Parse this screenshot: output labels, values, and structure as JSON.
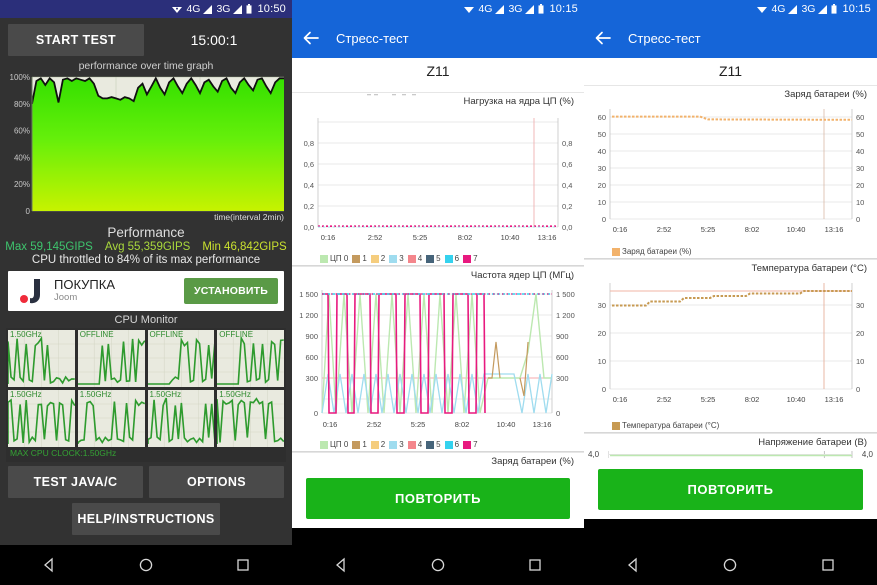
{
  "left": {
    "statusbar": {
      "wifi": "wifi-icon",
      "net1": "4G",
      "net2": "3G",
      "battery": "battery-icon",
      "time": "10:50"
    },
    "start_button": "START TEST",
    "timer": "15:00:1",
    "graph_title": "performance over time graph",
    "graph_xlabel": "time(interval 2min)",
    "y_ticks": [
      "100%",
      "80%",
      "60%",
      "40%",
      "20%",
      "0"
    ],
    "performance_heading": "Performance",
    "stat_max": "Max 59,145GIPS",
    "stat_avg": "Avg 55,359GIPS",
    "stat_min": "Min 46,842GIPS",
    "throttle_note": "CPU throttled to 84% of its max performance",
    "ad": {
      "title": "ПОКУПКА",
      "subtitle": "Joom",
      "cta": "УСТАНОВИТЬ",
      "logo": "joom-logo-icon"
    },
    "cpu_monitor_title": "CPU Monitor",
    "cpu_cores": [
      {
        "label": "1.50GHz",
        "state": "online"
      },
      {
        "label": "OFFLINE",
        "state": "offline"
      },
      {
        "label": "OFFLINE",
        "state": "offline"
      },
      {
        "label": "OFFLINE",
        "state": "offline"
      },
      {
        "label": "1.50GHz",
        "state": "online"
      },
      {
        "label": "1.50GHz",
        "state": "online"
      },
      {
        "label": "1.50GHz",
        "state": "online"
      },
      {
        "label": "1.50GHz",
        "state": "online"
      }
    ],
    "max_cpu_clock": "MAX CPU CLOCK:1.50GHz",
    "test_java_button": "TEST JAVA/C",
    "options_button": "OPTIONS",
    "help_button": "HELP/INSTRUCTIONS"
  },
  "middle": {
    "statusbar": {
      "net1": "4G",
      "net2": "3G",
      "time": "10:15"
    },
    "appbar_title": "Стресс-тест",
    "device_name": "Z11",
    "charts": [
      {
        "title": "Нагрузка на ядра ЦП (%)",
        "y_ticks": [
          "0,8",
          "0,6",
          "0,4",
          "0,2",
          "0,0"
        ],
        "x_ticks": [
          "0:16",
          "2:52",
          "5:25",
          "8:02",
          "10:40",
          "13:16"
        ],
        "legend": [
          "ЦП 0",
          "1",
          "2",
          "3",
          "4",
          "5",
          "6",
          "7"
        ]
      },
      {
        "title": "Частота ядер ЦП (МГц)",
        "y_ticks": [
          "1 500",
          "1 200",
          "900",
          "600",
          "300",
          "0"
        ],
        "x_ticks": [
          "0:16",
          "2:52",
          "5:25",
          "8:02",
          "10:40",
          "13:16"
        ],
        "legend": [
          "ЦП 0",
          "1",
          "2",
          "3",
          "4",
          "5",
          "6",
          "7"
        ]
      },
      {
        "title": "Заряд батареи (%)"
      }
    ],
    "repeat_button": "ПОВТОРИТЬ"
  },
  "right": {
    "statusbar": {
      "net1": "4G",
      "net2": "3G",
      "time": "10:15"
    },
    "appbar_title": "Стресс-тест",
    "device_name": "Z11",
    "charts": [
      {
        "title": "Заряд батареи (%)",
        "y_ticks": [
          "60",
          "50",
          "40",
          "30",
          "20",
          "10",
          "0"
        ],
        "x_ticks": [
          "0:16",
          "2:52",
          "5:25",
          "8:02",
          "10:40",
          "13:16"
        ],
        "legend": [
          "Заряд батареи (%)"
        ]
      },
      {
        "title": "Температура батареи (°C)",
        "y_ticks": [
          "30",
          "20",
          "10",
          "0"
        ],
        "x_ticks": [
          "0:16",
          "2:52",
          "5:25",
          "8:02",
          "10:40",
          "13:16"
        ],
        "legend": [
          "Температура батареи (°C)"
        ]
      },
      {
        "title": "Напряжение батареи (В)",
        "left_tick": "4,0",
        "right_tick": "4,0"
      }
    ],
    "repeat_button": "ПОВТОРИТЬ"
  },
  "colors": {
    "accent_blue": "#1565d8",
    "status_dark": "#2b2f7a",
    "green_button": "#19b319",
    "graph_green": "#4bdd00",
    "cpu_green": "#2e9b2e",
    "series": [
      "#bce8b0",
      "#c49a5e",
      "#f5cd7e",
      "#9fdcef",
      "#f4868c",
      "#46647a",
      "#35d2ee",
      "#e8197f"
    ],
    "battery_orange": "#f2b26b",
    "temp_brown": "#c79a52"
  },
  "chart_data": [
    {
      "type": "line",
      "panel": "middle",
      "title": "Нагрузка на ядра ЦП (%)",
      "xlabel": "",
      "ylabel": "",
      "ylim": [
        0,
        0.9
      ],
      "yticks": [
        0.0,
        0.2,
        0.4,
        0.6,
        0.8
      ],
      "x": [
        "0:16",
        "2:52",
        "5:25",
        "8:02",
        "10:40",
        "13:16"
      ],
      "grid": true,
      "legend_position": "bottom",
      "series": [
        {
          "name": "ЦП 0",
          "color": "#bce8b0",
          "values": [
            0,
            0,
            0,
            0,
            0,
            0
          ]
        },
        {
          "name": "1",
          "color": "#c49a5e",
          "values": [
            0,
            0,
            0,
            0,
            0,
            0
          ]
        },
        {
          "name": "2",
          "color": "#f5cd7e",
          "values": [
            0,
            0,
            0,
            0,
            0,
            0
          ]
        },
        {
          "name": "3",
          "color": "#9fdcef",
          "values": [
            0,
            0,
            0,
            0,
            0,
            0
          ]
        },
        {
          "name": "4",
          "color": "#f4868c",
          "values": [
            0,
            0,
            0,
            0,
            0,
            0
          ]
        },
        {
          "name": "5",
          "color": "#46647a",
          "values": [
            0,
            0,
            0,
            0,
            0,
            0
          ]
        },
        {
          "name": "6",
          "color": "#35d2ee",
          "values": [
            0,
            0,
            0,
            0,
            0,
            0
          ]
        },
        {
          "name": "7",
          "color": "#e8197f",
          "values": [
            0,
            0,
            0,
            0,
            0,
            0
          ]
        }
      ]
    },
    {
      "type": "line",
      "panel": "middle",
      "title": "Частота ядер ЦП (МГц)",
      "ylim": [
        0,
        1600
      ],
      "yticks": [
        0,
        300,
        600,
        900,
        1200,
        1500
      ],
      "x": [
        "0:16",
        "2:52",
        "5:25",
        "8:02",
        "10:40",
        "13:16"
      ],
      "grid": true,
      "legend_position": "bottom",
      "series": [
        {
          "name": "ЦП 0",
          "color": "#bce8b0",
          "note": "oscillates 0-1500, sawtooth"
        },
        {
          "name": "1",
          "color": "#c49a5e"
        },
        {
          "name": "2",
          "color": "#f5cd7e"
        },
        {
          "name": "3",
          "color": "#9fdcef",
          "note": "sawtooth 0-960"
        },
        {
          "name": "4",
          "color": "#f4868c"
        },
        {
          "name": "5",
          "color": "#46647a"
        },
        {
          "name": "6",
          "color": "#35d2ee",
          "note": "flat at 1500"
        },
        {
          "name": "7",
          "color": "#e8197f",
          "note": "square wave 0/1500"
        }
      ]
    },
    {
      "type": "line",
      "panel": "right",
      "title": "Заряд батареи (%)",
      "ylim": [
        0,
        65
      ],
      "yticks": [
        0,
        10,
        20,
        30,
        40,
        50,
        60
      ],
      "x": [
        "0:16",
        "2:52",
        "5:25",
        "8:02",
        "10:40",
        "13:16"
      ],
      "grid": true,
      "legend_position": "bottom",
      "series": [
        {
          "name": "Заряд батареи (%)",
          "color": "#f2b26b",
          "values": [
            59,
            59,
            58,
            58,
            58,
            58
          ]
        }
      ]
    },
    {
      "type": "line",
      "panel": "right",
      "title": "Температура батареи (°C)",
      "ylim": [
        0,
        37
      ],
      "yticks": [
        0,
        10,
        20,
        30
      ],
      "x": [
        "0:16",
        "2:52",
        "5:25",
        "8:02",
        "10:40",
        "13:16"
      ],
      "grid": true,
      "legend_position": "bottom",
      "series": [
        {
          "name": "Температура батареи (°C)",
          "color": "#c79a52",
          "values": [
            30,
            30.5,
            31.5,
            32,
            33.5,
            34.5
          ]
        }
      ]
    },
    {
      "type": "line",
      "panel": "right",
      "title": "Напряжение батареи (В)",
      "ylim": [
        4.0,
        4.0
      ],
      "yticks": [
        4.0
      ],
      "series": [
        {
          "name": "Напряжение батареи (В)",
          "color": "#bce8b0",
          "values": [
            4.0,
            4.0
          ]
        }
      ]
    },
    {
      "type": "area",
      "panel": "left",
      "title": "performance over time graph",
      "xlabel": "time(interval 2min)",
      "ylabel": "",
      "ylim": [
        0,
        100
      ],
      "yticks": [
        0,
        20,
        40,
        60,
        80,
        100
      ],
      "grid": true,
      "values": [
        80,
        97,
        99,
        94,
        99,
        96,
        81,
        98,
        99,
        97,
        99,
        98,
        97,
        99,
        95,
        86,
        84,
        84,
        85,
        84,
        83,
        85,
        84,
        82,
        92,
        95,
        87,
        93,
        99,
        92,
        87,
        96,
        99,
        93,
        88,
        95,
        99,
        94,
        88,
        96,
        98,
        93,
        89,
        97,
        99,
        92,
        88,
        96,
        99,
        94,
        90,
        98,
        99,
        93,
        88,
        96,
        99,
        99
      ],
      "annotations": {
        "max": "Max 59,145GIPS",
        "avg": "Avg 55,359GIPS",
        "min": "Min 46,842GIPS",
        "note": "CPU throttled to 84% of its max performance"
      }
    }
  ]
}
